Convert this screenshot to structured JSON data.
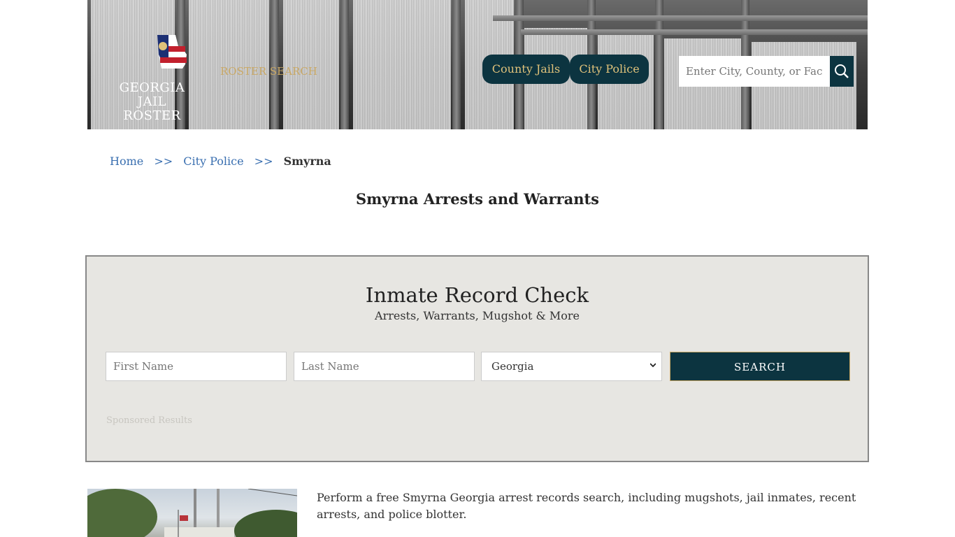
{
  "header": {
    "logo_line1": "GEORGIA",
    "logo_line2": "JAIL ROSTER",
    "roster_search": "ROSTER SEARCH",
    "nav": [
      {
        "label": "County Jails"
      },
      {
        "label": "City Police"
      }
    ],
    "search_placeholder": "Enter City, County, or Facil"
  },
  "breadcrumb": {
    "home": "Home",
    "sep": ">>",
    "city_police": "City Police",
    "current": "Smyrna"
  },
  "page_title": "Smyrna Arrests and Warrants",
  "record_check": {
    "title": "Inmate Record Check",
    "subtitle": "Arrests, Warrants, Mugshot & More",
    "first_name_placeholder": "First Name",
    "last_name_placeholder": "Last Name",
    "state_selected": "Georgia",
    "search_label": "SEARCH",
    "sponsored": "Sponsored Results"
  },
  "intro_text": "Perform a free Smyrna Georgia arrest records search, including mugshots, jail inmates, recent arrests, and police blotter.",
  "colors": {
    "brand_dark": "#0c3440",
    "gold": "#c9a865",
    "link": "#3a6fb0",
    "panel": "#e7e6e2"
  }
}
